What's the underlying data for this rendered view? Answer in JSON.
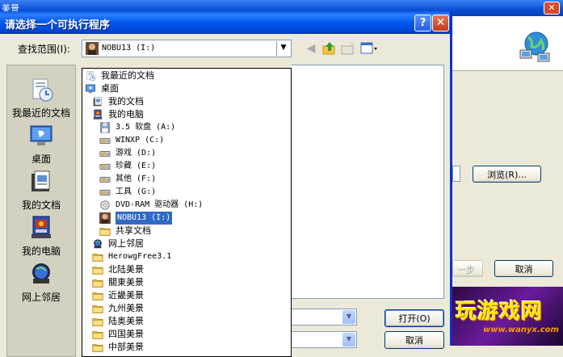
{
  "background_window": {
    "title": "美景",
    "browse_label": "浏览(R)...",
    "prev_label": "< 上一步(B)",
    "cancel_label": "取消",
    "ad_text": "玩游戏网",
    "ad_url": "www.wanyx.com"
  },
  "dialog": {
    "title": "请选择一个可执行程序",
    "help_label": "?",
    "close_label": "✕",
    "lookin_label": "查找范围(I):",
    "lookin_value": "NOBU13 (I:)",
    "open_label": "打开(O)",
    "cancel_label": "取消"
  },
  "places": [
    {
      "label": "我最近的文档",
      "icon": "recent-docs-icon"
    },
    {
      "label": "桌面",
      "icon": "desktop-icon"
    },
    {
      "label": "我的文档",
      "icon": "my-documents-icon"
    },
    {
      "label": "我的电脑",
      "icon": "my-computer-icon"
    },
    {
      "label": "网上邻居",
      "icon": "network-icon"
    }
  ],
  "dropdown_items": [
    {
      "label": "我最近的文档",
      "icon": "recent-docs-icon",
      "level": 0
    },
    {
      "label": "桌面",
      "icon": "desktop-icon",
      "level": 0
    },
    {
      "label": "我的文档",
      "icon": "my-documents-icon",
      "level": 1
    },
    {
      "label": "我的电脑",
      "icon": "my-computer-icon",
      "level": 1
    },
    {
      "label": "3.5 软盘 (A:)",
      "icon": "floppy-icon",
      "level": 2
    },
    {
      "label": "WINXP (C:)",
      "icon": "drive-icon",
      "level": 2
    },
    {
      "label": "游戏 (D:)",
      "icon": "drive-icon",
      "level": 2
    },
    {
      "label": "珍藏 (E:)",
      "icon": "drive-icon",
      "level": 2
    },
    {
      "label": "其他 (F:)",
      "icon": "drive-icon",
      "level": 2
    },
    {
      "label": "工具 (G:)",
      "icon": "drive-icon",
      "level": 2
    },
    {
      "label": "DVD-RAM 驱动器 (H:)",
      "icon": "dvd-icon",
      "level": 2
    },
    {
      "label": "NOBU13 (I:)",
      "icon": "nobu-drive-icon",
      "level": 2,
      "selected": true
    },
    {
      "label": "共享文档",
      "icon": "folder-icon",
      "level": 2
    },
    {
      "label": "网上邻居",
      "icon": "network-icon",
      "level": 1
    },
    {
      "label": "HerowgFree3.1",
      "icon": "folder-icon",
      "level": 1
    },
    {
      "label": "北陆美景",
      "icon": "folder-icon",
      "level": 1
    },
    {
      "label": "關東美景",
      "icon": "folder-icon",
      "level": 1
    },
    {
      "label": "近畿美景",
      "icon": "folder-icon",
      "level": 1
    },
    {
      "label": "九州美景",
      "icon": "folder-icon",
      "level": 1
    },
    {
      "label": "陆奥美景",
      "icon": "folder-icon",
      "level": 1
    },
    {
      "label": "四国美景",
      "icon": "folder-icon",
      "level": 1
    },
    {
      "label": "中部美景",
      "icon": "folder-icon",
      "level": 1
    }
  ]
}
